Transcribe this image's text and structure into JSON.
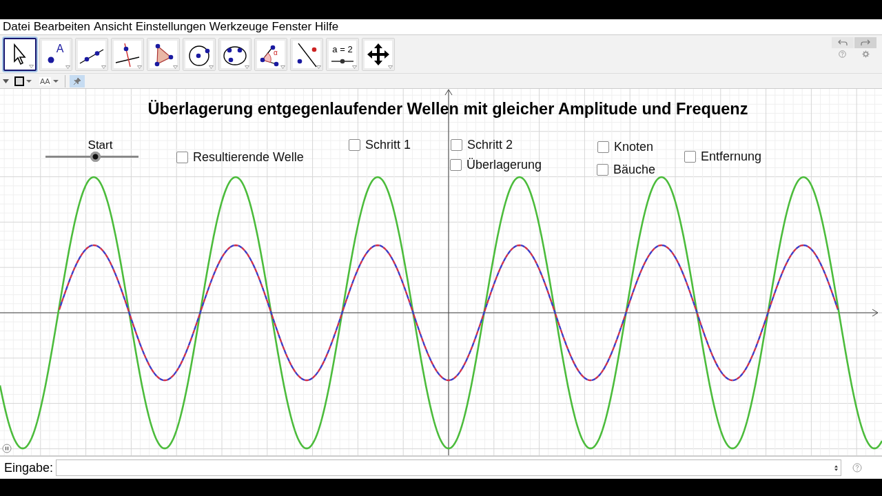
{
  "menu": [
    "Datei",
    "Bearbeiten",
    "Ansicht",
    "Einstellungen",
    "Werkzeuge",
    "Fenster",
    "Hilfe"
  ],
  "tools": [
    {
      "selected": true
    },
    {
      "selected": false,
      "label": "A"
    },
    {
      "selected": false
    },
    {
      "selected": false
    },
    {
      "selected": false
    },
    {
      "selected": false
    },
    {
      "selected": false
    },
    {
      "selected": false,
      "label": "α"
    },
    {
      "selected": false
    },
    {
      "selected": false,
      "label": "a = 2"
    },
    {
      "selected": false
    }
  ],
  "style_bar": {
    "font_button": "AA",
    "pin_on": true
  },
  "graphics": {
    "title": "Überlagerung entgegenlaufender Wellen mit gleicher Amplitude und Frequenz",
    "slider": {
      "label": "Start",
      "level": 0.53
    },
    "checkboxes": [
      {
        "label": "Resultierende Welle",
        "checked": false
      },
      {
        "label": "Schritt 1",
        "checked": false
      },
      {
        "label": "Schritt 2",
        "checked": false
      },
      {
        "label": "Überlagerung",
        "checked": false
      },
      {
        "label": "Knoten",
        "checked": false
      },
      {
        "label": "Bäuche",
        "checked": false
      },
      {
        "label": "Entfernung",
        "checked": false
      }
    ]
  },
  "input_bar": {
    "label": "Eingabe:"
  }
}
